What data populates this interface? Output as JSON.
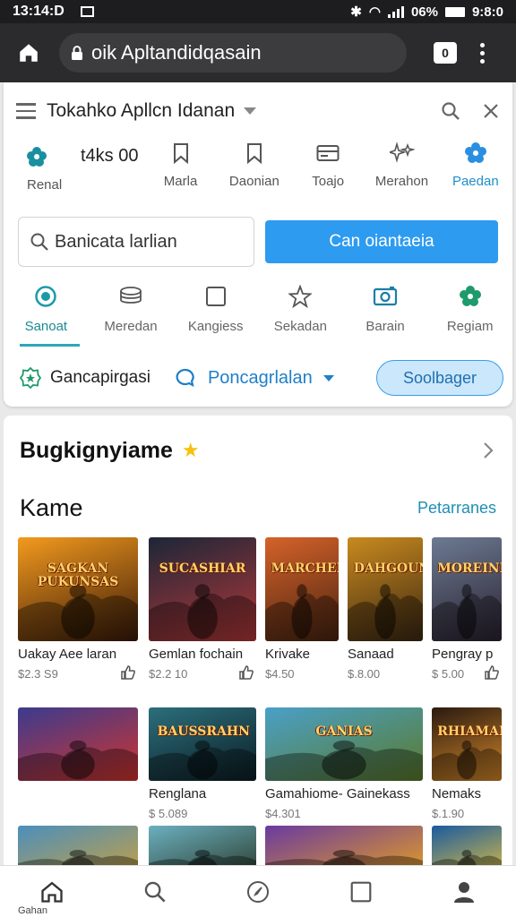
{
  "status_bar": {
    "time": "13:14:D",
    "battery": "06%",
    "clock_right": "9:8:0"
  },
  "browser": {
    "url": "oik Apltandidqasain",
    "tab_count": "0"
  },
  "app_header": {
    "title": "Tokahko Apllcn Idanan"
  },
  "categories": [
    {
      "label": "Renal",
      "icon": "flower-icon",
      "extra": "t4ks 00"
    },
    {
      "label": "Marla",
      "icon": "bookmark-icon"
    },
    {
      "label": "Daonian",
      "icon": "bookmark-outline-icon"
    },
    {
      "label": "Toajo",
      "icon": "card-icon"
    },
    {
      "label": "Merahon",
      "icon": "sparkle-icon"
    },
    {
      "label": "Paedan",
      "icon": "gear-flower-icon",
      "active": true
    }
  ],
  "search": {
    "value": "Banicata larlian",
    "button_label": "Can oiantaeia"
  },
  "filters": [
    {
      "label": "Sanoat",
      "icon": "radio-icon",
      "active": true
    },
    {
      "label": "Meredan",
      "icon": "stack-icon"
    },
    {
      "label": "Kangiess",
      "icon": "square-icon"
    },
    {
      "label": "Sekadan",
      "icon": "star-icon"
    },
    {
      "label": "Barain",
      "icon": "camera-icon"
    },
    {
      "label": "Regiam",
      "icon": "flower-icon"
    }
  ],
  "actions": {
    "left_label": "Gancapirgasi",
    "middle_label": "Poncagrlalan",
    "pill_label": "Soolbager"
  },
  "section": {
    "title": "Bugkignyiame",
    "sub_title": "Kame",
    "more_link": "Petarranes"
  },
  "games_row1": [
    {
      "name": "Uakay Aee laran",
      "price": "$2.3 S9",
      "art_text": "SAGKAN PUKUNSAS",
      "colors": [
        "#f39a1e",
        "#3a1a08"
      ],
      "has_thumb": true
    },
    {
      "name": "Gemlan fochain",
      "price": "$2.2 10",
      "art_text": "SUCASHIAR",
      "colors": [
        "#1c2638",
        "#b23838"
      ],
      "has_thumb": true
    },
    {
      "name": "Krivake",
      "price": "$4.50",
      "art_text": "MARCHELAN",
      "colors": [
        "#d5622a",
        "#4a2410"
      ],
      "has_thumb": false
    },
    {
      "name": "Sanaad",
      "price": "$.8.00",
      "art_text": "DAHGOUN",
      "colors": [
        "#c98a1f",
        "#3d2812"
      ],
      "has_thumb": false
    },
    {
      "name": "Pengray p",
      "price": "$ 5.00",
      "art_text": "MOREINH",
      "colors": [
        "#6c7a92",
        "#2a2230"
      ],
      "has_thumb": true
    }
  ],
  "games_row2": [
    {
      "name": "",
      "price": "",
      "art_text": "",
      "colors": [
        "#3a3b8f",
        "#d2342c"
      ]
    },
    {
      "name": "Renglana",
      "price": "$ 5.089",
      "art_text": "BAUSSRAHN",
      "colors": [
        "#2b6f7c",
        "#0c1d24"
      ]
    },
    {
      "name": "Gamahiome- Gainekass",
      "price": "$4.301",
      "art_text": "GANIAS",
      "colors": [
        "#4aa0c8",
        "#5a7a2a"
      ]
    },
    {
      "name": "Nemaks",
      "price": "$.1.90",
      "art_text": "RHIAMAN",
      "colors": [
        "#2a1a10",
        "#d2862a"
      ]
    }
  ],
  "games_row3_colors": [
    [
      "#4b8fbd",
      "#c9a040"
    ],
    [
      "#6bb0c0",
      "#2a3a2a"
    ],
    [
      "#6a3aa0",
      "#e6a020"
    ],
    [
      "#1a5aa0",
      "#e0c040"
    ]
  ],
  "bottom_nav": [
    {
      "label": "Gahan",
      "icon": "home-icon"
    },
    {
      "label": "",
      "icon": "search-icon"
    },
    {
      "label": "",
      "icon": "compass-icon"
    },
    {
      "label": "",
      "icon": "square-icon"
    },
    {
      "label": "",
      "icon": "person-icon"
    }
  ],
  "colors": {
    "accent_blue": "#2d9bf0",
    "accent_teal": "#1b8a94",
    "star_yellow": "#f5c20c"
  }
}
